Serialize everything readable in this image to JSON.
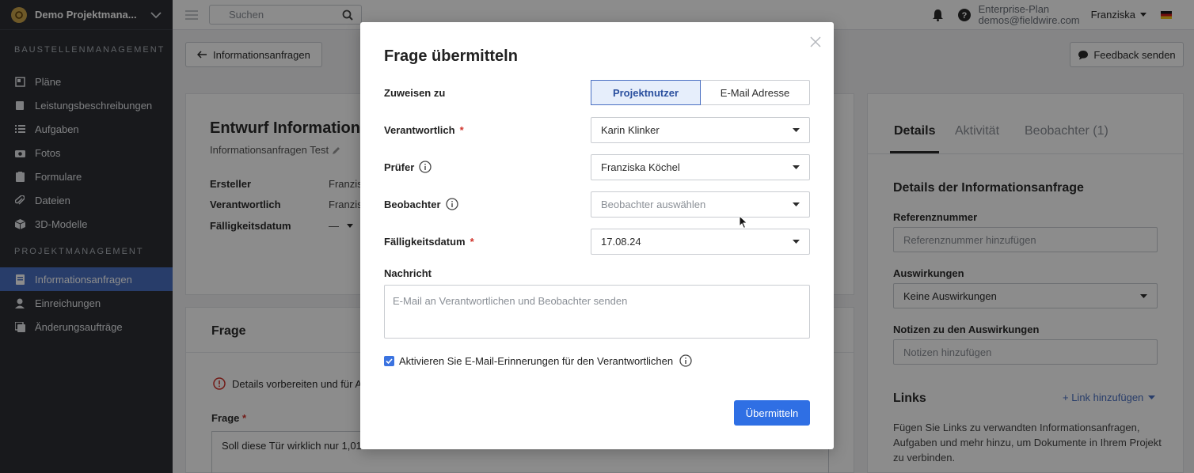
{
  "sidebar": {
    "project": "Demo Projektmana...",
    "section1": "BAUSTELLENMANAGEMENT",
    "items1": [
      {
        "label": "Pläne",
        "icon": "plans-icon"
      },
      {
        "label": "Leistungsbeschreibungen",
        "icon": "specs-icon"
      },
      {
        "label": "Aufgaben",
        "icon": "tasks-icon"
      },
      {
        "label": "Fotos",
        "icon": "camera-icon"
      },
      {
        "label": "Formulare",
        "icon": "forms-icon"
      },
      {
        "label": "Dateien",
        "icon": "paperclip-icon"
      },
      {
        "label": "3D-Modelle",
        "icon": "cube-icon"
      }
    ],
    "section2": "PROJEKTMANAGEMENT",
    "items2": [
      {
        "label": "Informationsanfragen",
        "icon": "rfi-icon",
        "active": true
      },
      {
        "label": "Einreichungen",
        "icon": "submittals-icon"
      },
      {
        "label": "Änderungsaufträge",
        "icon": "change-orders-icon"
      }
    ]
  },
  "topbar": {
    "search_placeholder": "Suchen",
    "plan": "Enterprise-Plan",
    "email": "demos@fieldwire.com",
    "user": "Franziska"
  },
  "page": {
    "back_label": "Informationsanfragen",
    "feedback_label": "Feedback senden",
    "title": "Entwurf Informations",
    "subtitle": "Informationsanfragen Test",
    "meta": [
      {
        "label": "Ersteller",
        "value": "Franzis"
      },
      {
        "label": "Verantwortlich",
        "value": "Franzis"
      },
      {
        "label": "Fälligkeitsdatum",
        "value": "—"
      }
    ],
    "question_section": "Frage",
    "warning": "Details vorbereiten und für A",
    "question_label": "Frage",
    "question_text": "Soll diese Tür wirklich nur 1,01"
  },
  "right_panel": {
    "tabs": [
      "Details",
      "Aktivität",
      "Beobachter (1)"
    ],
    "title": "Details der Informationsanfrage",
    "ref_label": "Referenznummer",
    "ref_placeholder": "Referenznummer hinzufügen",
    "impact_label": "Auswirkungen",
    "impact_value": "Keine Auswirkungen",
    "notes_label": "Notizen zu den Auswirkungen",
    "notes_placeholder": "Notizen hinzufügen",
    "links_label": "Links",
    "add_link": "+ Link hinzufügen",
    "links_desc": "Fügen Sie Links zu verwandten Informationsanfragen, Aufgaben und mehr hinzu, um Dokumente in Ihrem Projekt zu verbinden."
  },
  "modal": {
    "title": "Frage übermitteln",
    "assign_label": "Zuweisen zu",
    "assign_options": [
      "Projektnutzer",
      "E-Mail Adresse"
    ],
    "responsible_label": "Verantwortlich",
    "responsible_value": "Karin Klinker",
    "reviewer_label": "Prüfer",
    "reviewer_value": "Franziska Köchel",
    "watchers_label": "Beobachter",
    "watchers_placeholder": "Beobachter auswählen",
    "due_label": "Fälligkeitsdatum",
    "due_value": "17.08.24",
    "message_label": "Nachricht",
    "message_placeholder": "E-Mail an Verantwortlichen und Beobachter senden",
    "reminder_label": "Aktivieren Sie E-Mail-Erinnerungen für den Verantwortlichen",
    "reminder_checked": true,
    "submit_label": "Übermitteln",
    "required_mark": "*"
  },
  "colors": {
    "accent": "#2f6fe4",
    "sidebar_bg": "#2c2f34",
    "active_nav": "#4a70c2",
    "required": "#d0342c"
  }
}
